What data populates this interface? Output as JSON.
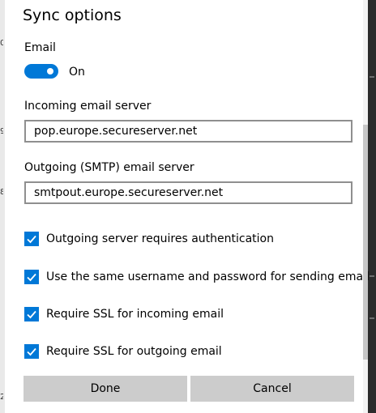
{
  "dialog": {
    "title": "Sync options",
    "email_section": {
      "label": "Email",
      "toggle_state": "On",
      "toggle_on": true
    },
    "incoming": {
      "label": "Incoming email server",
      "value": "pop.europe.secureserver.net"
    },
    "outgoing": {
      "label": "Outgoing (SMTP) email server",
      "value": "smtpout.europe.secureserver.net"
    },
    "checkboxes": [
      {
        "label": "Outgoing server requires authentication",
        "checked": true
      },
      {
        "label": "Use the same username and password for sending email",
        "checked": true
      },
      {
        "label": "Require SSL for incoming email",
        "checked": true
      },
      {
        "label": "Require SSL for outgoing email",
        "checked": true
      }
    ],
    "buttons": {
      "done": "Done",
      "cancel": "Cancel"
    }
  },
  "colors": {
    "accent": "#0078d7",
    "button_bg": "#cccccc",
    "field_border": "#8f8f8f"
  }
}
